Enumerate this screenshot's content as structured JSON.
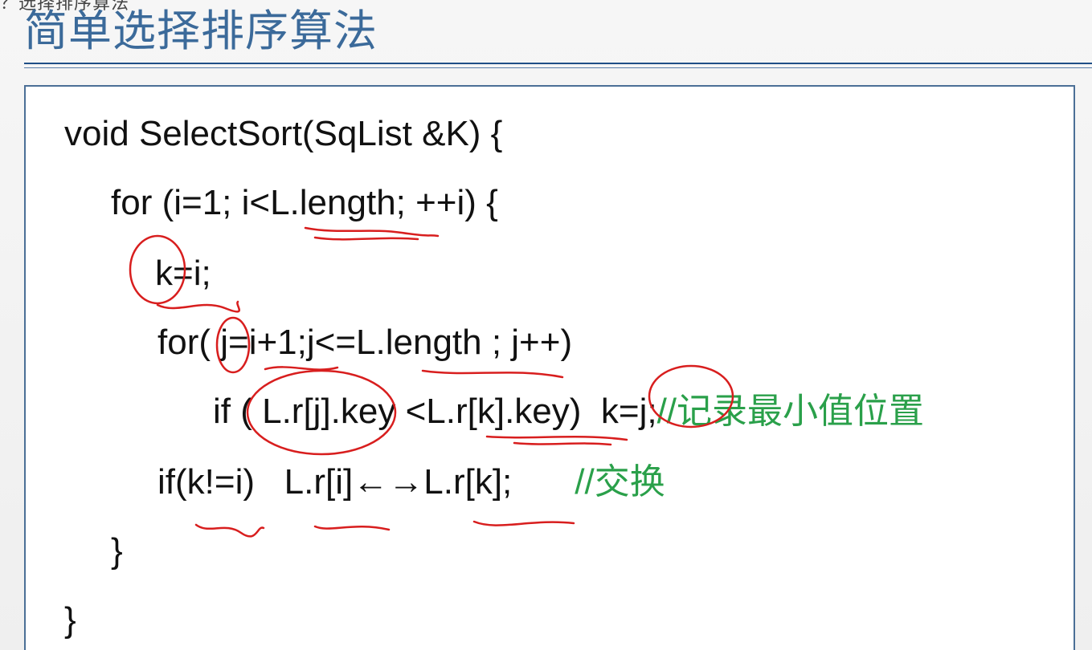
{
  "slide": {
    "caption_fragment": "？选择排序算法",
    "title": "简单选择排序算法",
    "code": {
      "line1": "void SelectSort(SqList &K) {",
      "line2": "for (i=1; i<L.length; ++i) {",
      "line3": "k=i;",
      "line4": "for( j=i+1;j<=L.length ; j++)",
      "line5_code": "if ( L.r[j].key <L.r[k].key)  k=j;",
      "line5_comment": "//记录最小值位置",
      "line6_code": "if(k!=i)   L.r[i]←→L.r[k];",
      "line6_comment": "//交换",
      "line7": "}",
      "line8": "}"
    }
  },
  "colors": {
    "title": "#3b6a9a",
    "comment": "#2aa04a",
    "annotation": "#d81e1e",
    "border": "#4b6f96"
  }
}
